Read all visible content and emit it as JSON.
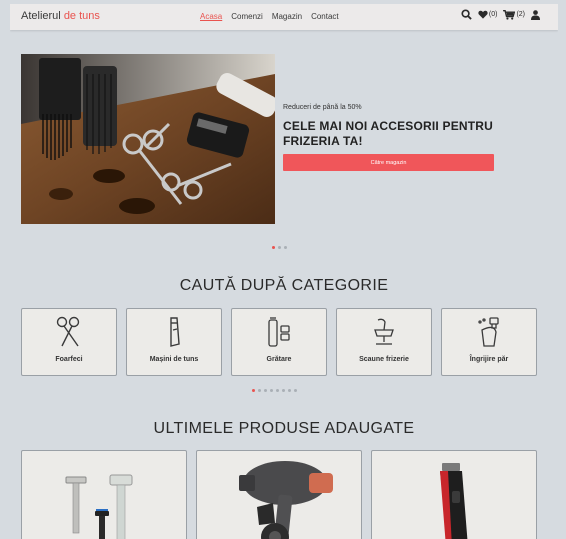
{
  "navbar": {
    "brand_main": "Atelierul",
    "brand_accent": "de tuns",
    "links": [
      "Acasa",
      "Comenzi",
      "Magazin",
      "Contact"
    ],
    "active_link": "Acasa",
    "wishlist_count": "(0)",
    "cart_count": "(2)",
    "icons": [
      "search-icon",
      "heart-icon",
      "cart-icon",
      "user-icon"
    ]
  },
  "hero": {
    "subtitle": "Reduceri de până la 50%",
    "title": "CELE MAI NOI ACCESORII PENTRU FRIZERIA TA!",
    "button": "Către magazin",
    "slide_count": 3,
    "active_slide": 0
  },
  "categories": {
    "title": "CAUTĂ DUPĂ CATEGORIE",
    "items": [
      {
        "label": "Foarfeci",
        "icon": "scissors-icon"
      },
      {
        "label": "Mașini de tuns",
        "icon": "clipper-icon"
      },
      {
        "label": "Grătare",
        "icon": "trimmer-icon"
      },
      {
        "label": "Scaune frizerie",
        "icon": "barber-chair-icon"
      },
      {
        "label": "Îngrijire păr",
        "icon": "spray-bottle-icon"
      }
    ],
    "page_count": 8,
    "active_page": 0
  },
  "products": {
    "title": "ULTIMELE PRODUSE ADAUGATE",
    "items": [
      {
        "image": "razors-image"
      },
      {
        "image": "hair-dryer-image"
      },
      {
        "image": "hair-clipper-image"
      }
    ]
  },
  "colors": {
    "accent": "#e9534f",
    "button": "#f0565a",
    "background": "#d6dbe0",
    "card": "#ecebe8",
    "navbar": "#eceaea"
  }
}
